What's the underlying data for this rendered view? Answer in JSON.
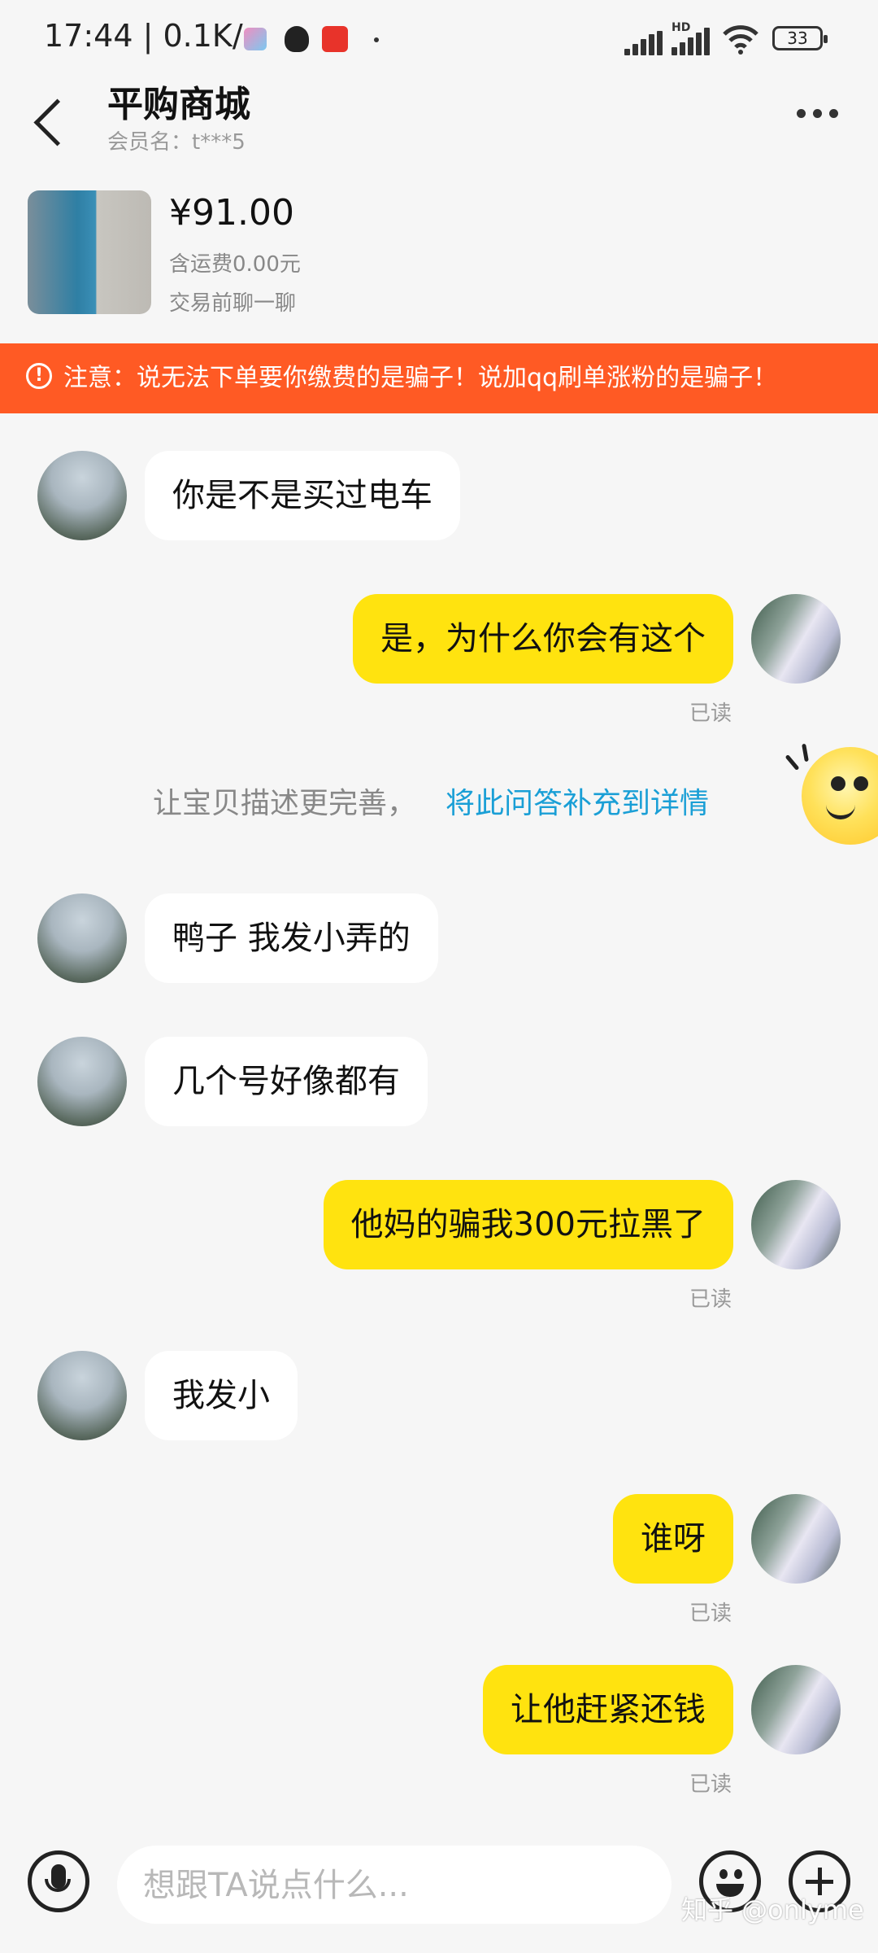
{
  "status_bar": {
    "time": "17:44",
    "network_speed": "0.1K/s",
    "signal_badge": "HD",
    "battery": "33"
  },
  "header": {
    "title": "平购商城",
    "member_label": "会员名：t***5"
  },
  "product": {
    "price": "¥91.00",
    "shipping": "含运费0.00元",
    "hint": "交易前聊一聊"
  },
  "warning": {
    "text": "注意：说无法下单要你缴费的是骗子！说加qq刷单涨粉的是骗子！"
  },
  "messages": [
    {
      "side": "left",
      "text": "你是不是买过电车"
    },
    {
      "side": "right",
      "text": "是，为什么你会有这个",
      "status": "已读"
    },
    {
      "side": "left",
      "text": "鸭子 我发小弄的"
    },
    {
      "side": "left",
      "text": "几个号好像都有"
    },
    {
      "side": "right",
      "text": "他妈的骗我300元拉黑了",
      "status": "已读"
    },
    {
      "side": "left",
      "text": "我发小"
    },
    {
      "side": "right",
      "text": "谁呀",
      "status": "已读"
    },
    {
      "side": "right",
      "text": "让他赶紧还钱",
      "status": "已读"
    }
  ],
  "suggestion": {
    "text": "让宝贝描述更完善，",
    "link": "将此问答补充到详情"
  },
  "input": {
    "placeholder": "想跟TA说点什么..."
  },
  "watermark": "知乎 @onlyme",
  "colors": {
    "accent_yellow": "#ffe30f",
    "warning_orange": "#ff5a24",
    "link_blue": "#1a9fd6"
  }
}
